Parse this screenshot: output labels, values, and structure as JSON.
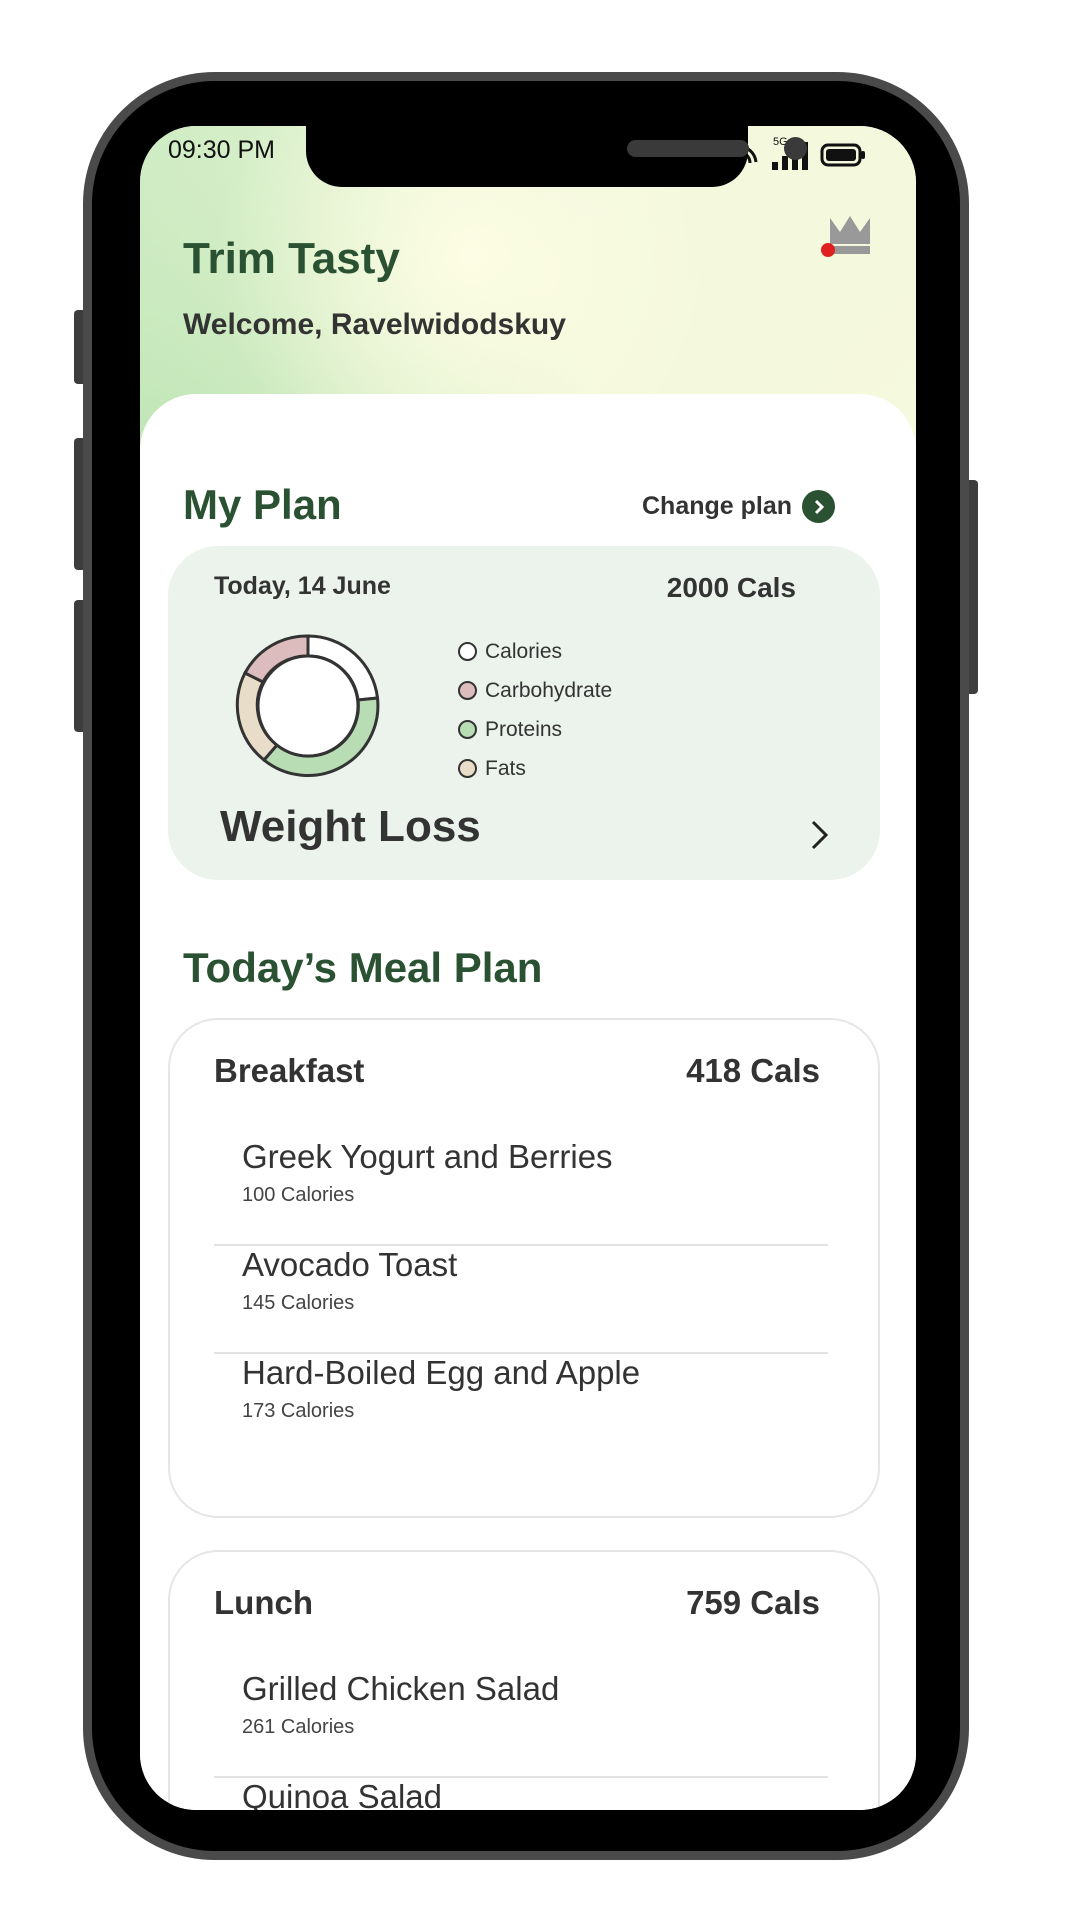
{
  "status_bar": {
    "time": "09:30 PM",
    "network": "5G"
  },
  "header": {
    "app_title": "Trim Tasty",
    "welcome": "Welcome, Ravelwidodskuy",
    "premium_icon": "crown-icon"
  },
  "my_plan": {
    "title": "My Plan",
    "change_plan_label": "Change plan",
    "date": "Today, 14 June",
    "total_cals": "2000 Cals",
    "plan_name": "Weight Loss",
    "legend": [
      {
        "label": "Calories",
        "color": "#ffffff"
      },
      {
        "label": "Carbohydrate",
        "color": "#dcbcbc"
      },
      {
        "label": "Proteins",
        "color": "#b8dcb4"
      },
      {
        "label": "Fats",
        "color": "#e8ddc8"
      }
    ]
  },
  "meal_plan": {
    "title": "Today’s Meal Plan",
    "meals": [
      {
        "name": "Breakfast",
        "cals": "418 Cals",
        "items": [
          {
            "name": "Greek Yogurt and Berries",
            "calories": "100 Calories"
          },
          {
            "name": "Avocado Toast",
            "calories": "145 Calories"
          },
          {
            "name": "Hard-Boiled Egg and Apple",
            "calories": "173 Calories"
          }
        ]
      },
      {
        "name": "Lunch",
        "cals": "759 Cals",
        "items": [
          {
            "name": "Grilled Chicken Salad",
            "calories": "261 Calories"
          },
          {
            "name": "Quinoa Salad",
            "calories": ""
          }
        ]
      }
    ]
  },
  "colors": {
    "brand_green": "#2a5232",
    "plan_card_bg": "#ebf3ec",
    "notification_dot": "#e02020"
  }
}
